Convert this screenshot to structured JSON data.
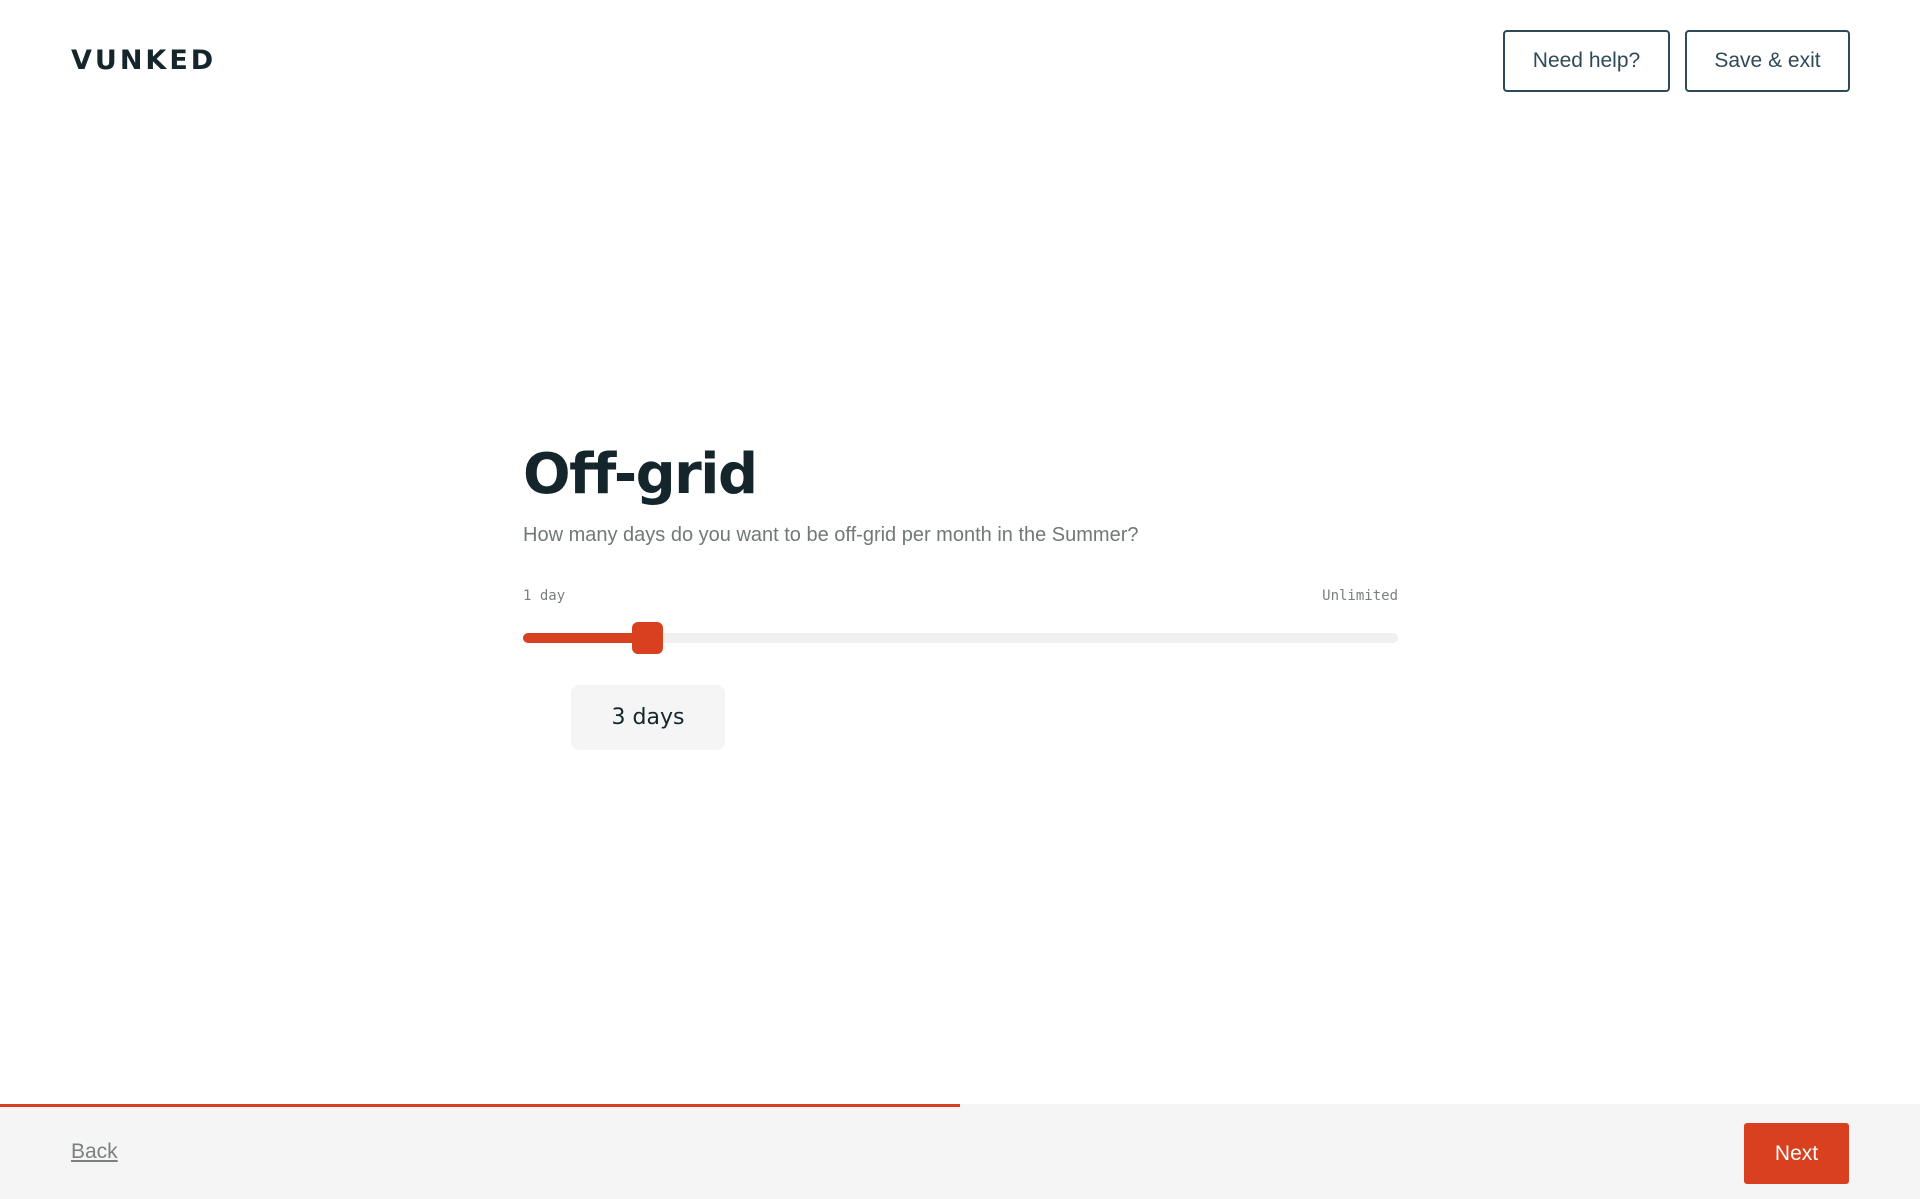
{
  "header": {
    "logo": "VUNKED",
    "help_label": "Need help?",
    "save_label": "Save & exit"
  },
  "main": {
    "title": "Off-grid",
    "question": "How many days do you want to be off-grid per month in the Summer?",
    "slider": {
      "min_label": "1 day",
      "max_label": "Unlimited",
      "value_label": "3 days",
      "value_fraction": 0.143
    }
  },
  "footer": {
    "back_label": "Back",
    "next_label": "Next",
    "progress_fraction": 0.5
  },
  "colors": {
    "accent": "#d9401f",
    "text_dark": "#14262b",
    "text_muted": "#707878",
    "footer_bg": "#f5f5f5"
  }
}
